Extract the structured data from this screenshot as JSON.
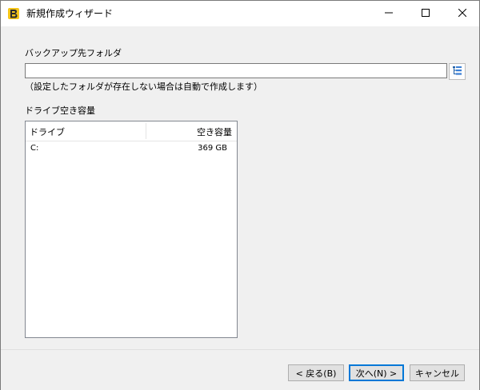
{
  "window": {
    "title": "新規作成ウィザード"
  },
  "form": {
    "backup_folder_label": "バックアップ先フォルダ",
    "backup_folder_value": "",
    "hint": "（設定したフォルダが存在しない場合は自動で作成します）",
    "drive_space_label": "ドライブ空き容量"
  },
  "drives": {
    "columns": [
      "ドライブ",
      "空き容量"
    ],
    "rows": [
      {
        "drive": "C:",
        "free": "369 GB"
      }
    ]
  },
  "buttons": {
    "back": "< 戻る(B)",
    "next": "次へ(N) >",
    "cancel": "キャンセル"
  },
  "icons": {
    "app": "app-logo-icon",
    "browse": "folder-tree-icon",
    "minimize": "minimize-icon",
    "maximize": "maximize-icon",
    "close": "close-icon"
  },
  "colors": {
    "accent": "#0078d7",
    "client_bg": "#f0f0f0",
    "app_icon_yellow": "#f5c518",
    "app_icon_dark": "#2b2b2b"
  }
}
